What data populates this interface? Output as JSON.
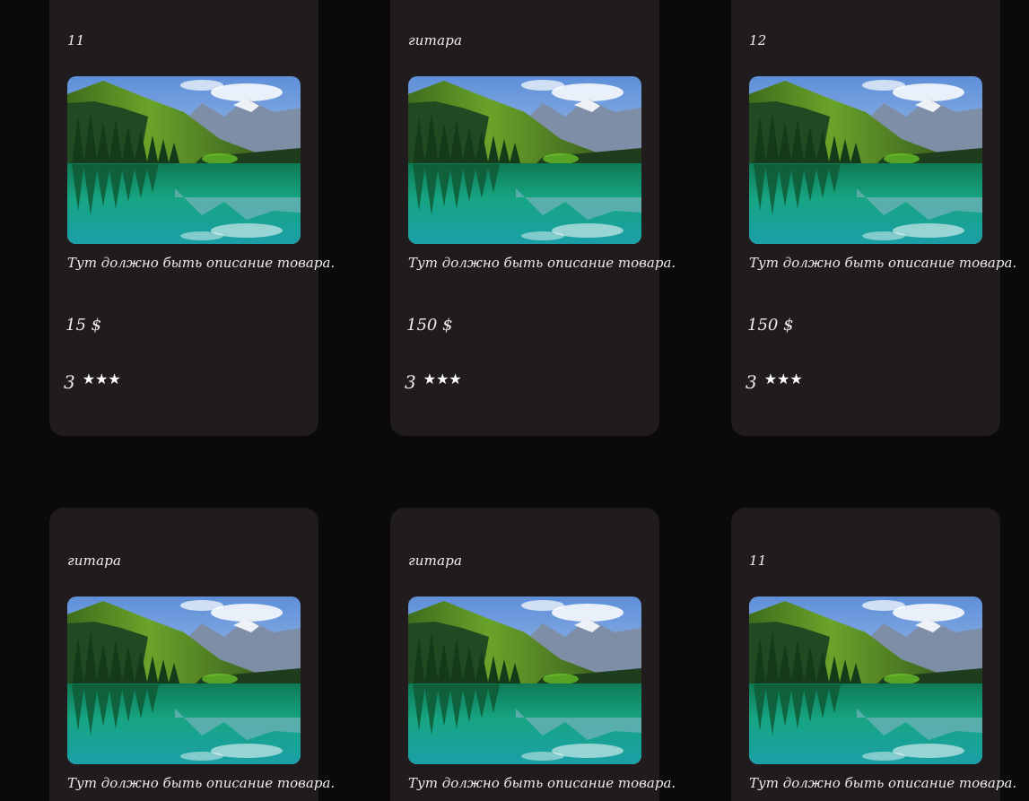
{
  "colors": {
    "page_background": "#0b0a0b",
    "card_background": "#201b1c",
    "text": "#f1ecec"
  },
  "image_description_icon": "landscape-photo",
  "products": [
    {
      "title": "11",
      "description": "Тут должно быть описание товара.",
      "price": "15 $",
      "rating": "3",
      "stars": "★★★"
    },
    {
      "title": "гитара",
      "description": "Тут должно быть описание товара.",
      "price": "150 $",
      "rating": "3",
      "stars": "★★★"
    },
    {
      "title": "12",
      "description": "Тут должно быть описание товара.",
      "price": "150 $",
      "rating": "3",
      "stars": "★★★"
    },
    {
      "title": "гитара",
      "description": "Тут должно быть описание товара."
    },
    {
      "title": "гитара",
      "description": "Тут должно быть описание товара."
    },
    {
      "title": "11",
      "description": "Тут должно быть описание товара."
    }
  ]
}
